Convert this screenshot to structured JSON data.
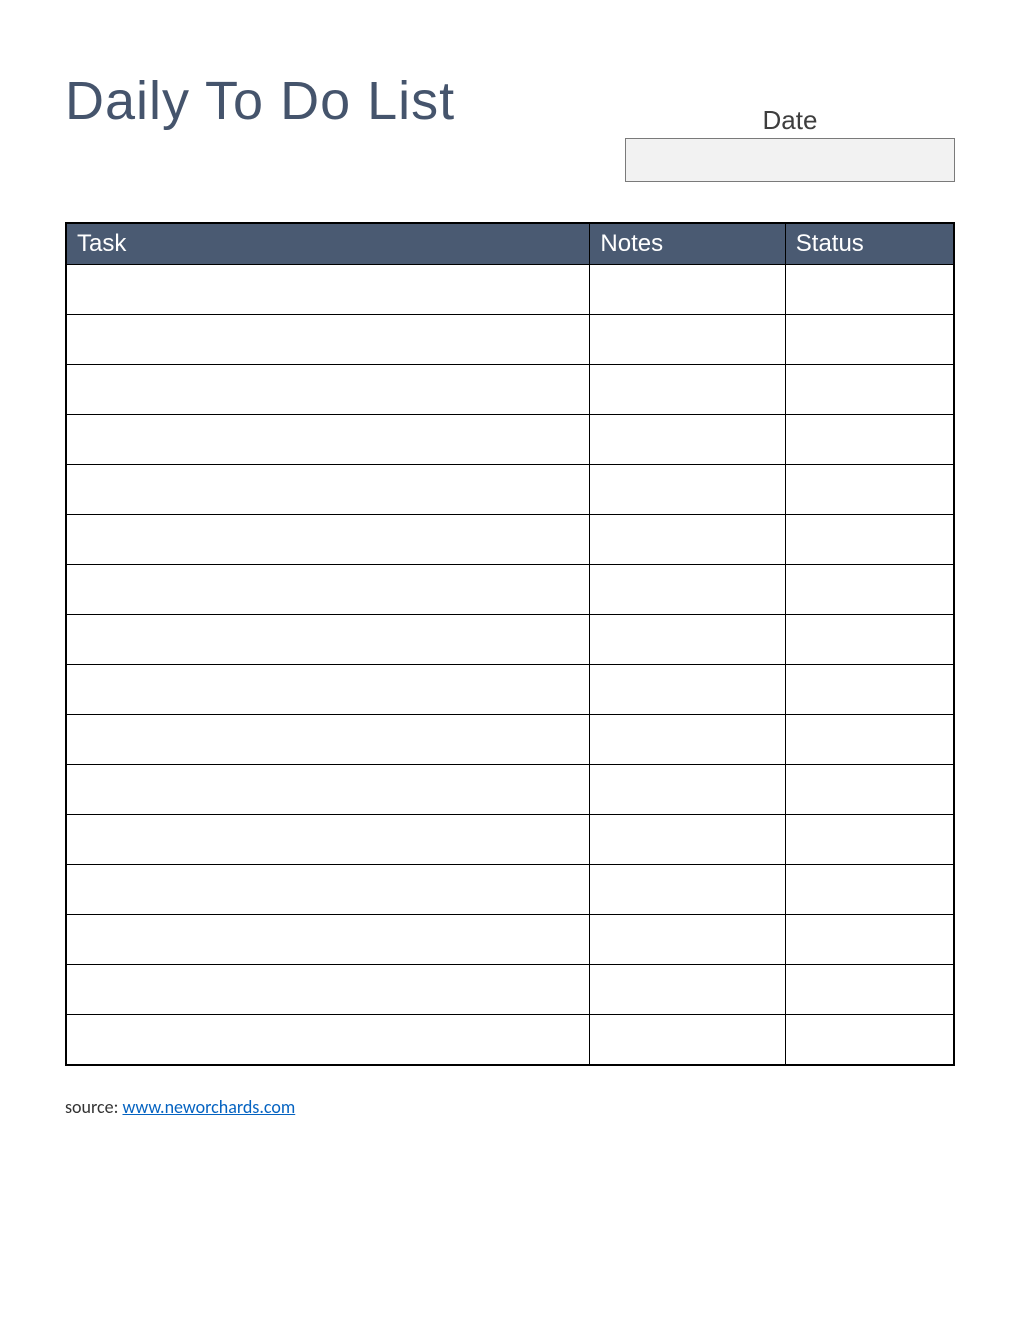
{
  "title": "Daily To Do List",
  "date": {
    "label": "Date",
    "value": ""
  },
  "columns": {
    "task": "Task",
    "notes": "Notes",
    "status": "Status"
  },
  "rows": [
    {
      "task": "",
      "notes": "",
      "status": ""
    },
    {
      "task": "",
      "notes": "",
      "status": ""
    },
    {
      "task": "",
      "notes": "",
      "status": ""
    },
    {
      "task": "",
      "notes": "",
      "status": ""
    },
    {
      "task": "",
      "notes": "",
      "status": ""
    },
    {
      "task": "",
      "notes": "",
      "status": ""
    },
    {
      "task": "",
      "notes": "",
      "status": ""
    },
    {
      "task": "",
      "notes": "",
      "status": ""
    },
    {
      "task": "",
      "notes": "",
      "status": ""
    },
    {
      "task": "",
      "notes": "",
      "status": ""
    },
    {
      "task": "",
      "notes": "",
      "status": ""
    },
    {
      "task": "",
      "notes": "",
      "status": ""
    },
    {
      "task": "",
      "notes": "",
      "status": ""
    },
    {
      "task": "",
      "notes": "",
      "status": ""
    },
    {
      "task": "",
      "notes": "",
      "status": ""
    },
    {
      "task": "",
      "notes": "",
      "status": ""
    }
  ],
  "source": {
    "prefix": "source: ",
    "link_text": "www.neworchards.com"
  },
  "colors": {
    "title_color": "#45546c",
    "header_bg": "#4a5a72",
    "header_text": "#ffffff",
    "date_bg": "#f2f2f2",
    "link_color": "#0563c1"
  }
}
